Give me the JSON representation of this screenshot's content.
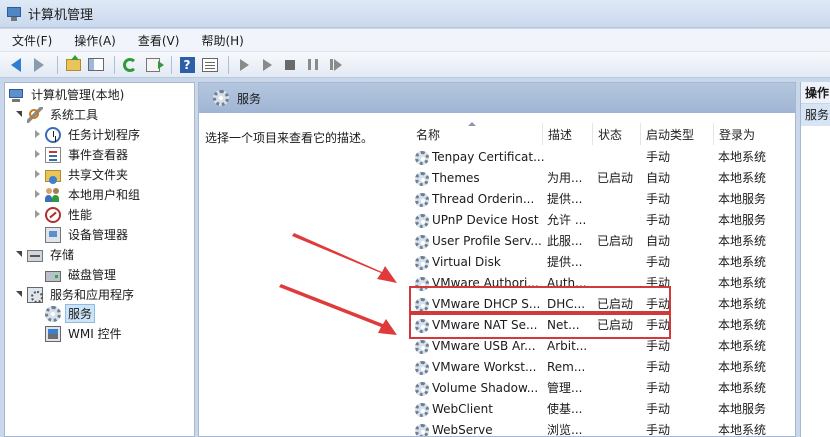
{
  "window": {
    "title": "计算机管理"
  },
  "menu": [
    {
      "label": "文件(F)"
    },
    {
      "label": "操作(A)"
    },
    {
      "label": "查看(V)"
    },
    {
      "label": "帮助(H)"
    }
  ],
  "toolbar": {
    "buttons": [
      "back-icon",
      "forward-icon",
      "up-folder-icon",
      "show-hide-tree-icon",
      "refresh-icon",
      "export-list-icon",
      "help-icon",
      "properties-icon",
      "start-service-icon",
      "start-service-icon",
      "stop-service-icon",
      "pause-service-icon",
      "restart-service-icon"
    ]
  },
  "tree": {
    "root": "计算机管理(本地)",
    "items": [
      {
        "label": "系统工具",
        "icon": "system-tools-icon"
      },
      {
        "label": "任务计划程序",
        "icon": "task-scheduler-icon"
      },
      {
        "label": "事件查看器",
        "icon": "event-viewer-icon"
      },
      {
        "label": "共享文件夹",
        "icon": "shared-folders-icon"
      },
      {
        "label": "本地用户和组",
        "icon": "local-users-icon"
      },
      {
        "label": "性能",
        "icon": "performance-icon"
      },
      {
        "label": "设备管理器",
        "icon": "device-manager-icon"
      },
      {
        "label": "存储",
        "icon": "storage-icon"
      },
      {
        "label": "磁盘管理",
        "icon": "disk-management-icon"
      },
      {
        "label": "服务和应用程序",
        "icon": "services-apps-icon"
      },
      {
        "label": "服务",
        "icon": "services-icon"
      },
      {
        "label": "WMI 控件",
        "icon": "wmi-icon"
      }
    ]
  },
  "services": {
    "title": "服务",
    "description": "选择一个项目来查看它的描述。",
    "columns": [
      "名称",
      "描述",
      "状态",
      "启动类型",
      "登录为"
    ],
    "rows": [
      {
        "name": "Tenpay Certificat...",
        "desc": "",
        "status": "",
        "startup": "手动",
        "logon": "本地系统"
      },
      {
        "name": "Themes",
        "desc": "为用...",
        "status": "已启动",
        "startup": "自动",
        "logon": "本地系统"
      },
      {
        "name": "Thread Orderin...",
        "desc": "提供...",
        "status": "",
        "startup": "手动",
        "logon": "本地服务"
      },
      {
        "name": "UPnP Device Host",
        "desc": "允许 ...",
        "status": "",
        "startup": "手动",
        "logon": "本地服务"
      },
      {
        "name": "User Profile Serv...",
        "desc": "此服...",
        "status": "已启动",
        "startup": "自动",
        "logon": "本地系统"
      },
      {
        "name": "Virtual Disk",
        "desc": "提供...",
        "status": "",
        "startup": "手动",
        "logon": "本地系统"
      },
      {
        "name": "VMware Authori...",
        "desc": "Auth...",
        "status": "",
        "startup": "手动",
        "logon": "本地系统"
      },
      {
        "name": "VMware DHCP S...",
        "desc": "DHC...",
        "status": "已启动",
        "startup": "手动",
        "logon": "本地系统"
      },
      {
        "name": "VMware NAT Se...",
        "desc": "Net...",
        "status": "已启动",
        "startup": "手动",
        "logon": "本地系统"
      },
      {
        "name": "VMware USB Ar...",
        "desc": "Arbit...",
        "status": "",
        "startup": "手动",
        "logon": "本地系统"
      },
      {
        "name": "VMware Workst...",
        "desc": "Rem...",
        "status": "",
        "startup": "手动",
        "logon": "本地系统"
      },
      {
        "name": "Volume Shadow...",
        "desc": "管理...",
        "status": "",
        "startup": "手动",
        "logon": "本地系统"
      },
      {
        "name": "WebClient",
        "desc": "使基...",
        "status": "",
        "startup": "手动",
        "logon": "本地服务"
      },
      {
        "name": "WebServe",
        "desc": "浏览...",
        "status": "",
        "startup": "手动",
        "logon": "本地系统"
      }
    ]
  },
  "actions": {
    "header": "操作",
    "subheader": "服务"
  },
  "colors": {
    "highlight": "#d23a3a",
    "annotation_arrow": "#e03b3b",
    "selection": "#cce4f7"
  }
}
